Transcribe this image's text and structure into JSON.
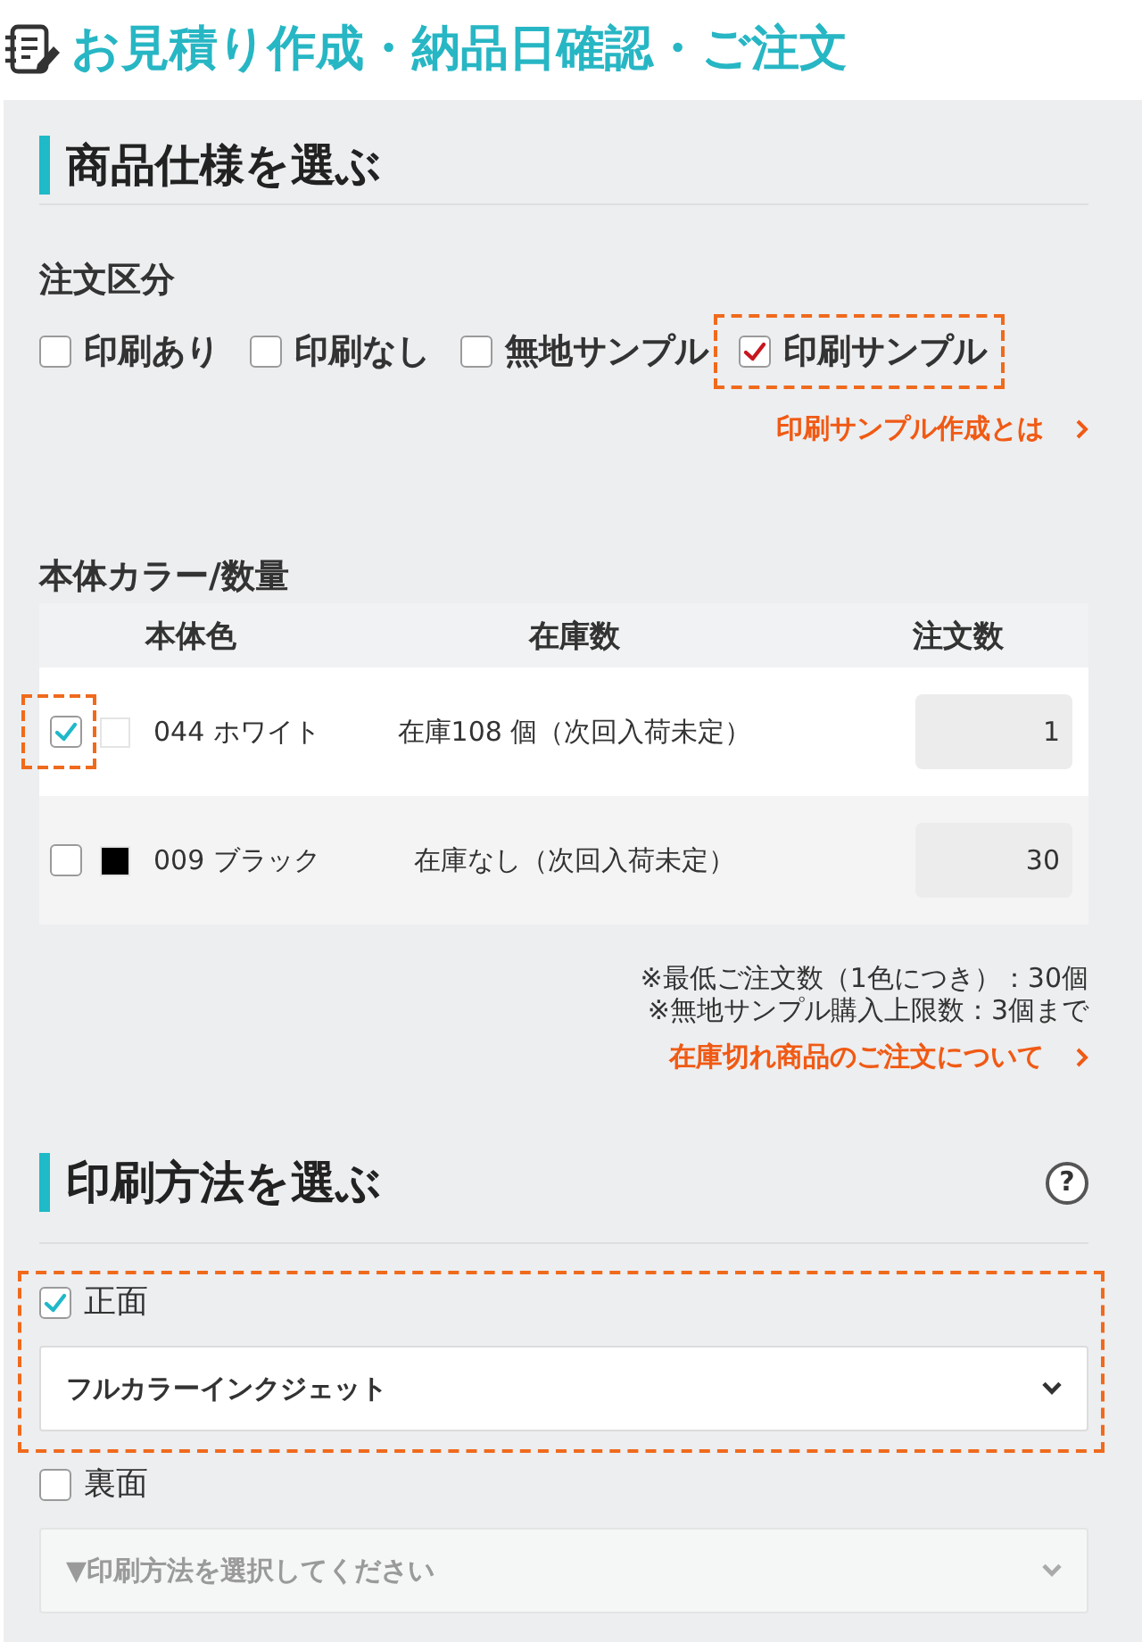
{
  "page_title": "お見積り作成・納品日確認・ご注文",
  "spec_section": {
    "heading": "商品仕様を選ぶ",
    "order_type": {
      "label": "注文区分",
      "options": [
        {
          "label": "印刷あり",
          "checked": false,
          "highlighted": false
        },
        {
          "label": "印刷なし",
          "checked": false,
          "highlighted": false
        },
        {
          "label": "無地サンプル",
          "checked": false,
          "highlighted": false
        },
        {
          "label": "印刷サンプル",
          "checked": true,
          "highlighted": true
        }
      ],
      "link": "印刷サンプル作成とは"
    },
    "color_quantity": {
      "label": "本体カラー/数量",
      "columns": [
        "本体色",
        "在庫数",
        "注文数"
      ],
      "rows": [
        {
          "checked": true,
          "highlighted": true,
          "color": "#ffffff",
          "name": "044 ホワイト",
          "stock": "在庫108 個（次回入荷未定）",
          "quantity": "1"
        },
        {
          "checked": false,
          "highlighted": false,
          "color": "#000000",
          "name": "009 ブラック",
          "stock": "在庫なし（次回入荷未定）",
          "quantity": "30"
        }
      ],
      "notes": [
        "※最低ご注文数（1色につき）：30個",
        "※無地サンプル購入上限数：3個まで"
      ],
      "link": "在庫切れ商品のご注文について"
    }
  },
  "print_section": {
    "heading": "印刷方法を選ぶ",
    "help": "?",
    "sides": [
      {
        "label": "正面",
        "checked": true,
        "highlighted": true,
        "disabled": false,
        "value": "フルカラーインクジェット"
      },
      {
        "label": "裏面",
        "checked": false,
        "highlighted": false,
        "disabled": true,
        "placeholder": "▼印刷方法を選択してください"
      }
    ]
  }
}
